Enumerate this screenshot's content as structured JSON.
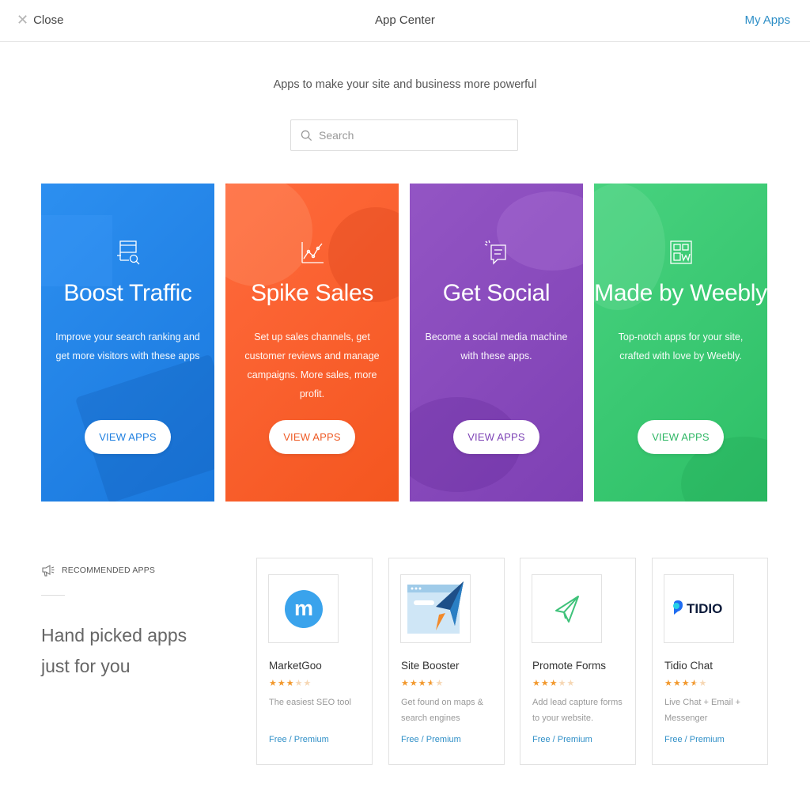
{
  "header": {
    "close_label": "Close",
    "title": "App Center",
    "my_apps_label": "My Apps"
  },
  "subtitle": "Apps to make your site and business more powerful",
  "search": {
    "placeholder": "Search"
  },
  "categories": [
    {
      "title": "Boost Traffic",
      "description": "Improve your search ranking and get more visitors with these apps",
      "button": "VIEW APPS",
      "icon": "search-traffic-icon",
      "color": "#1e7fe0"
    },
    {
      "title": "Spike Sales",
      "description": "Set up sales channels, get customer reviews and manage campaigns. More sales, more profit.",
      "button": "VIEW APPS",
      "icon": "chart-line-icon",
      "color": "#f4561f"
    },
    {
      "title": "Get Social",
      "description": "Become a social media machine with these apps.",
      "button": "VIEW APPS",
      "icon": "chat-bubble-icon",
      "color": "#8448b9"
    },
    {
      "title": "Made by Weebly",
      "description": "Top-notch apps for your site, crafted with love by Weebly.",
      "button": "VIEW APPS",
      "icon": "weebly-grid-icon",
      "color": "#34c66d"
    }
  ],
  "recommended": {
    "label": "RECOMMENDED APPS",
    "tagline": "Hand picked apps just for you",
    "apps": [
      {
        "name": "MarketGoo",
        "rating": 3,
        "description": "The easiest SEO tool",
        "price": "Free / Premium",
        "logo": "marketgoo-logo"
      },
      {
        "name": "Site Booster",
        "rating": 3.5,
        "description": "Get found on maps & search engines",
        "price": "Free / Premium",
        "logo": "site-booster-logo"
      },
      {
        "name": "Promote Forms",
        "rating": 3,
        "description": "Add lead capture forms to your website.",
        "price": "Free / Premium",
        "logo": "paper-plane-logo"
      },
      {
        "name": "Tidio Chat",
        "rating": 3.5,
        "description": "Live Chat + Email + Messenger",
        "price": "Free / Premium",
        "logo": "tidio-logo",
        "logo_text": "TIDIO"
      }
    ]
  }
}
